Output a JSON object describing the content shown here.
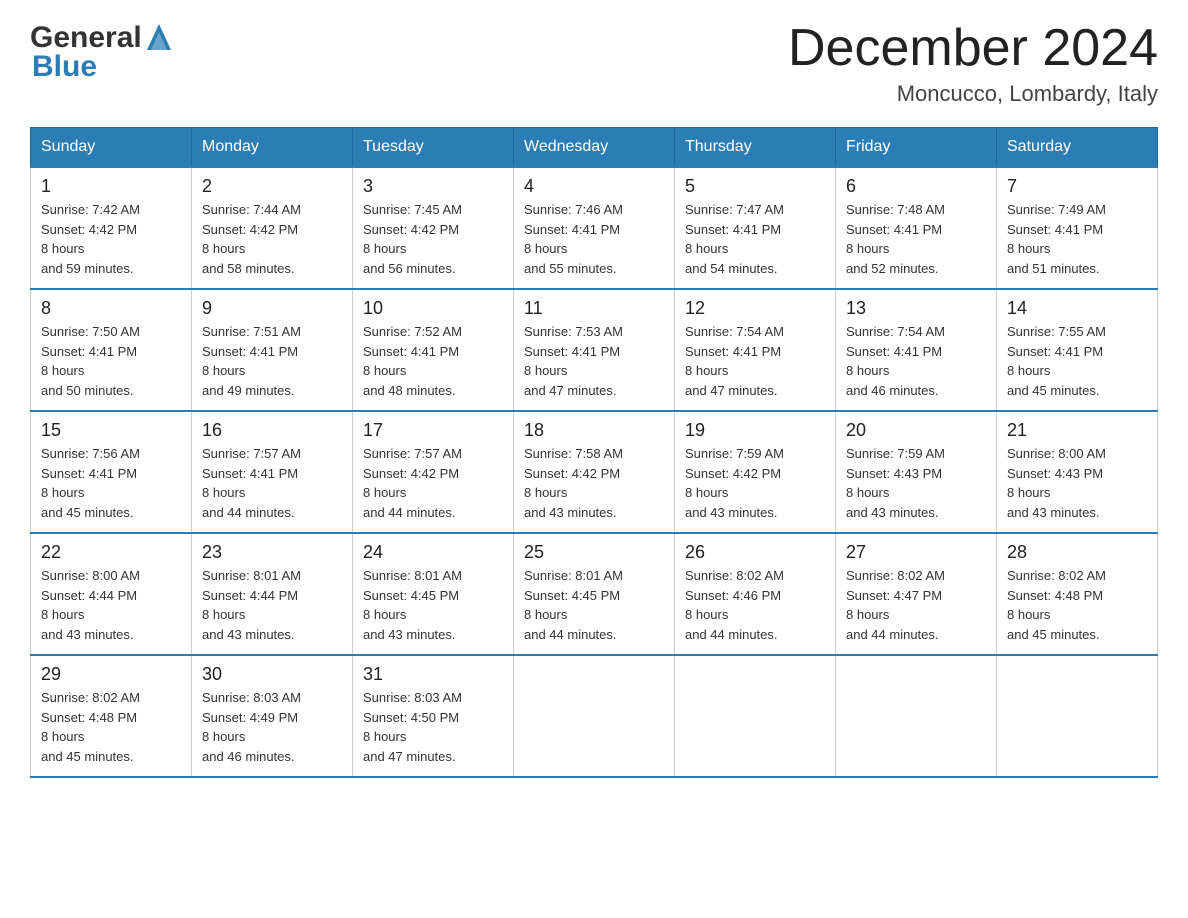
{
  "header": {
    "logo": {
      "text_general": "General",
      "text_blue": "Blue"
    },
    "title": "December 2024",
    "subtitle": "Moncucco, Lombardy, Italy"
  },
  "days_of_week": [
    "Sunday",
    "Monday",
    "Tuesday",
    "Wednesday",
    "Thursday",
    "Friday",
    "Saturday"
  ],
  "weeks": [
    [
      {
        "day": "1",
        "sunrise": "7:42 AM",
        "sunset": "4:42 PM",
        "daylight": "8 hours and 59 minutes."
      },
      {
        "day": "2",
        "sunrise": "7:44 AM",
        "sunset": "4:42 PM",
        "daylight": "8 hours and 58 minutes."
      },
      {
        "day": "3",
        "sunrise": "7:45 AM",
        "sunset": "4:42 PM",
        "daylight": "8 hours and 56 minutes."
      },
      {
        "day": "4",
        "sunrise": "7:46 AM",
        "sunset": "4:41 PM",
        "daylight": "8 hours and 55 minutes."
      },
      {
        "day": "5",
        "sunrise": "7:47 AM",
        "sunset": "4:41 PM",
        "daylight": "8 hours and 54 minutes."
      },
      {
        "day": "6",
        "sunrise": "7:48 AM",
        "sunset": "4:41 PM",
        "daylight": "8 hours and 52 minutes."
      },
      {
        "day": "7",
        "sunrise": "7:49 AM",
        "sunset": "4:41 PM",
        "daylight": "8 hours and 51 minutes."
      }
    ],
    [
      {
        "day": "8",
        "sunrise": "7:50 AM",
        "sunset": "4:41 PM",
        "daylight": "8 hours and 50 minutes."
      },
      {
        "day": "9",
        "sunrise": "7:51 AM",
        "sunset": "4:41 PM",
        "daylight": "8 hours and 49 minutes."
      },
      {
        "day": "10",
        "sunrise": "7:52 AM",
        "sunset": "4:41 PM",
        "daylight": "8 hours and 48 minutes."
      },
      {
        "day": "11",
        "sunrise": "7:53 AM",
        "sunset": "4:41 PM",
        "daylight": "8 hours and 47 minutes."
      },
      {
        "day": "12",
        "sunrise": "7:54 AM",
        "sunset": "4:41 PM",
        "daylight": "8 hours and 47 minutes."
      },
      {
        "day": "13",
        "sunrise": "7:54 AM",
        "sunset": "4:41 PM",
        "daylight": "8 hours and 46 minutes."
      },
      {
        "day": "14",
        "sunrise": "7:55 AM",
        "sunset": "4:41 PM",
        "daylight": "8 hours and 45 minutes."
      }
    ],
    [
      {
        "day": "15",
        "sunrise": "7:56 AM",
        "sunset": "4:41 PM",
        "daylight": "8 hours and 45 minutes."
      },
      {
        "day": "16",
        "sunrise": "7:57 AM",
        "sunset": "4:41 PM",
        "daylight": "8 hours and 44 minutes."
      },
      {
        "day": "17",
        "sunrise": "7:57 AM",
        "sunset": "4:42 PM",
        "daylight": "8 hours and 44 minutes."
      },
      {
        "day": "18",
        "sunrise": "7:58 AM",
        "sunset": "4:42 PM",
        "daylight": "8 hours and 43 minutes."
      },
      {
        "day": "19",
        "sunrise": "7:59 AM",
        "sunset": "4:42 PM",
        "daylight": "8 hours and 43 minutes."
      },
      {
        "day": "20",
        "sunrise": "7:59 AM",
        "sunset": "4:43 PM",
        "daylight": "8 hours and 43 minutes."
      },
      {
        "day": "21",
        "sunrise": "8:00 AM",
        "sunset": "4:43 PM",
        "daylight": "8 hours and 43 minutes."
      }
    ],
    [
      {
        "day": "22",
        "sunrise": "8:00 AM",
        "sunset": "4:44 PM",
        "daylight": "8 hours and 43 minutes."
      },
      {
        "day": "23",
        "sunrise": "8:01 AM",
        "sunset": "4:44 PM",
        "daylight": "8 hours and 43 minutes."
      },
      {
        "day": "24",
        "sunrise": "8:01 AM",
        "sunset": "4:45 PM",
        "daylight": "8 hours and 43 minutes."
      },
      {
        "day": "25",
        "sunrise": "8:01 AM",
        "sunset": "4:45 PM",
        "daylight": "8 hours and 44 minutes."
      },
      {
        "day": "26",
        "sunrise": "8:02 AM",
        "sunset": "4:46 PM",
        "daylight": "8 hours and 44 minutes."
      },
      {
        "day": "27",
        "sunrise": "8:02 AM",
        "sunset": "4:47 PM",
        "daylight": "8 hours and 44 minutes."
      },
      {
        "day": "28",
        "sunrise": "8:02 AM",
        "sunset": "4:48 PM",
        "daylight": "8 hours and 45 minutes."
      }
    ],
    [
      {
        "day": "29",
        "sunrise": "8:02 AM",
        "sunset": "4:48 PM",
        "daylight": "8 hours and 45 minutes."
      },
      {
        "day": "30",
        "sunrise": "8:03 AM",
        "sunset": "4:49 PM",
        "daylight": "8 hours and 46 minutes."
      },
      {
        "day": "31",
        "sunrise": "8:03 AM",
        "sunset": "4:50 PM",
        "daylight": "8 hours and 47 minutes."
      },
      null,
      null,
      null,
      null
    ]
  ]
}
